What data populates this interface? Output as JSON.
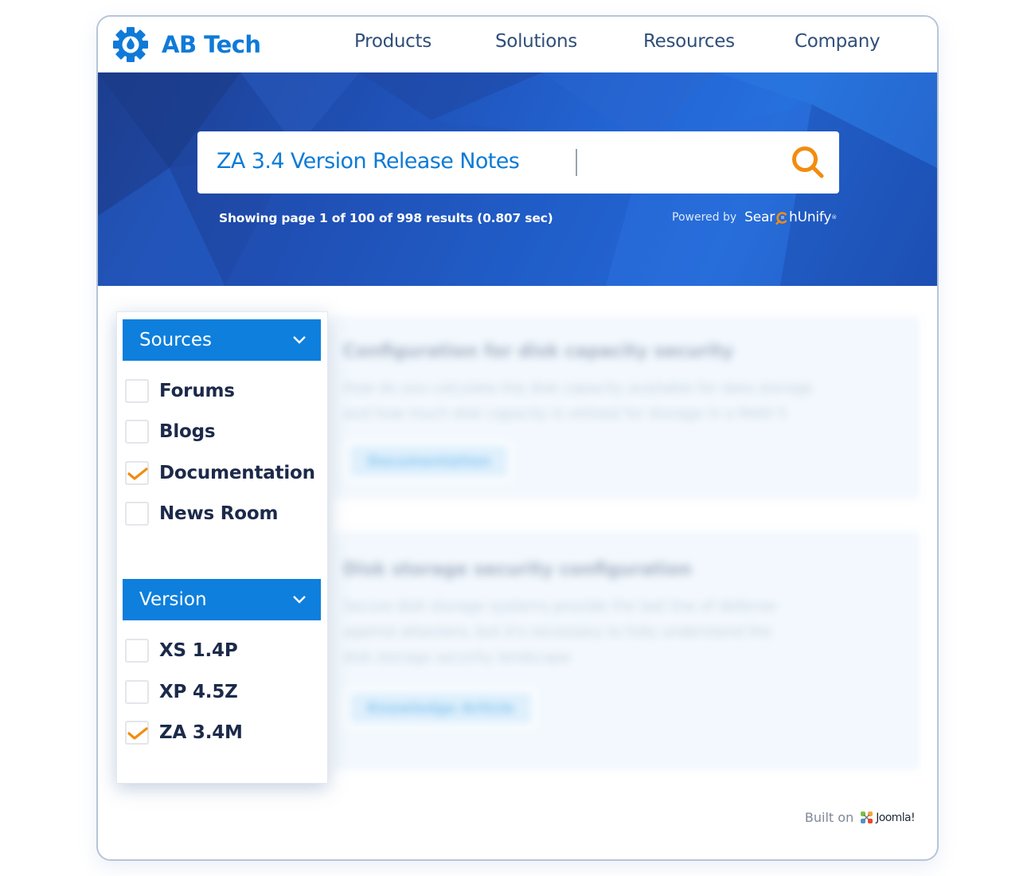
{
  "brand": {
    "name": "AB Tech",
    "logo_icon": "gear-droplet-icon",
    "color": "#0f7ad8"
  },
  "nav": {
    "items": [
      {
        "label": "Products"
      },
      {
        "label": "Solutions"
      },
      {
        "label": "Resources"
      },
      {
        "label": "Company"
      }
    ]
  },
  "search": {
    "value": "ZA 3.4 Version Release Notes",
    "button_icon": "search-icon",
    "button_color": "#f28c0f",
    "results_info": "Showing page 1 of 100 of 998 results (0.807 sec)",
    "powered_by_label": "Powered by",
    "powered_by_brand_prefix": "Sear",
    "powered_by_brand_suffix": "hUnify"
  },
  "filters": {
    "facets": [
      {
        "title": "Sources",
        "expanded": true,
        "options": [
          {
            "label": "Forums",
            "checked": false
          },
          {
            "label": "Blogs",
            "checked": false
          },
          {
            "label": "Documentation",
            "checked": true
          },
          {
            "label": "News Room",
            "checked": false
          }
        ]
      },
      {
        "title": "Version",
        "expanded": true,
        "options": [
          {
            "label": "XS 1.4P",
            "checked": false
          },
          {
            "label": "XP 4.5Z",
            "checked": false
          },
          {
            "label": "ZA 3.4M",
            "checked": true
          }
        ]
      }
    ],
    "header_color": "#0e7fdc",
    "check_color": "#f28c0f"
  },
  "results": [
    {
      "title": "Configuration for disk capacity security",
      "snippet_lines": [
        "How do you calculate the disk capacity available for data storage",
        "and how much disk capacity is utilized for storage in a RAID 5"
      ],
      "tag": "Documentation",
      "blurred": true
    },
    {
      "title": "Disk storage security configuration",
      "snippet_lines": [
        "Secure disk storage systems provide the last line of defense",
        "against attackers, but it's necessary to fully understand the",
        "disk storage security landscape"
      ],
      "tag": "Knowledge Article",
      "blurred": true
    }
  ],
  "footer": {
    "built_on_label": "Built on",
    "platform": "Joomla!"
  }
}
